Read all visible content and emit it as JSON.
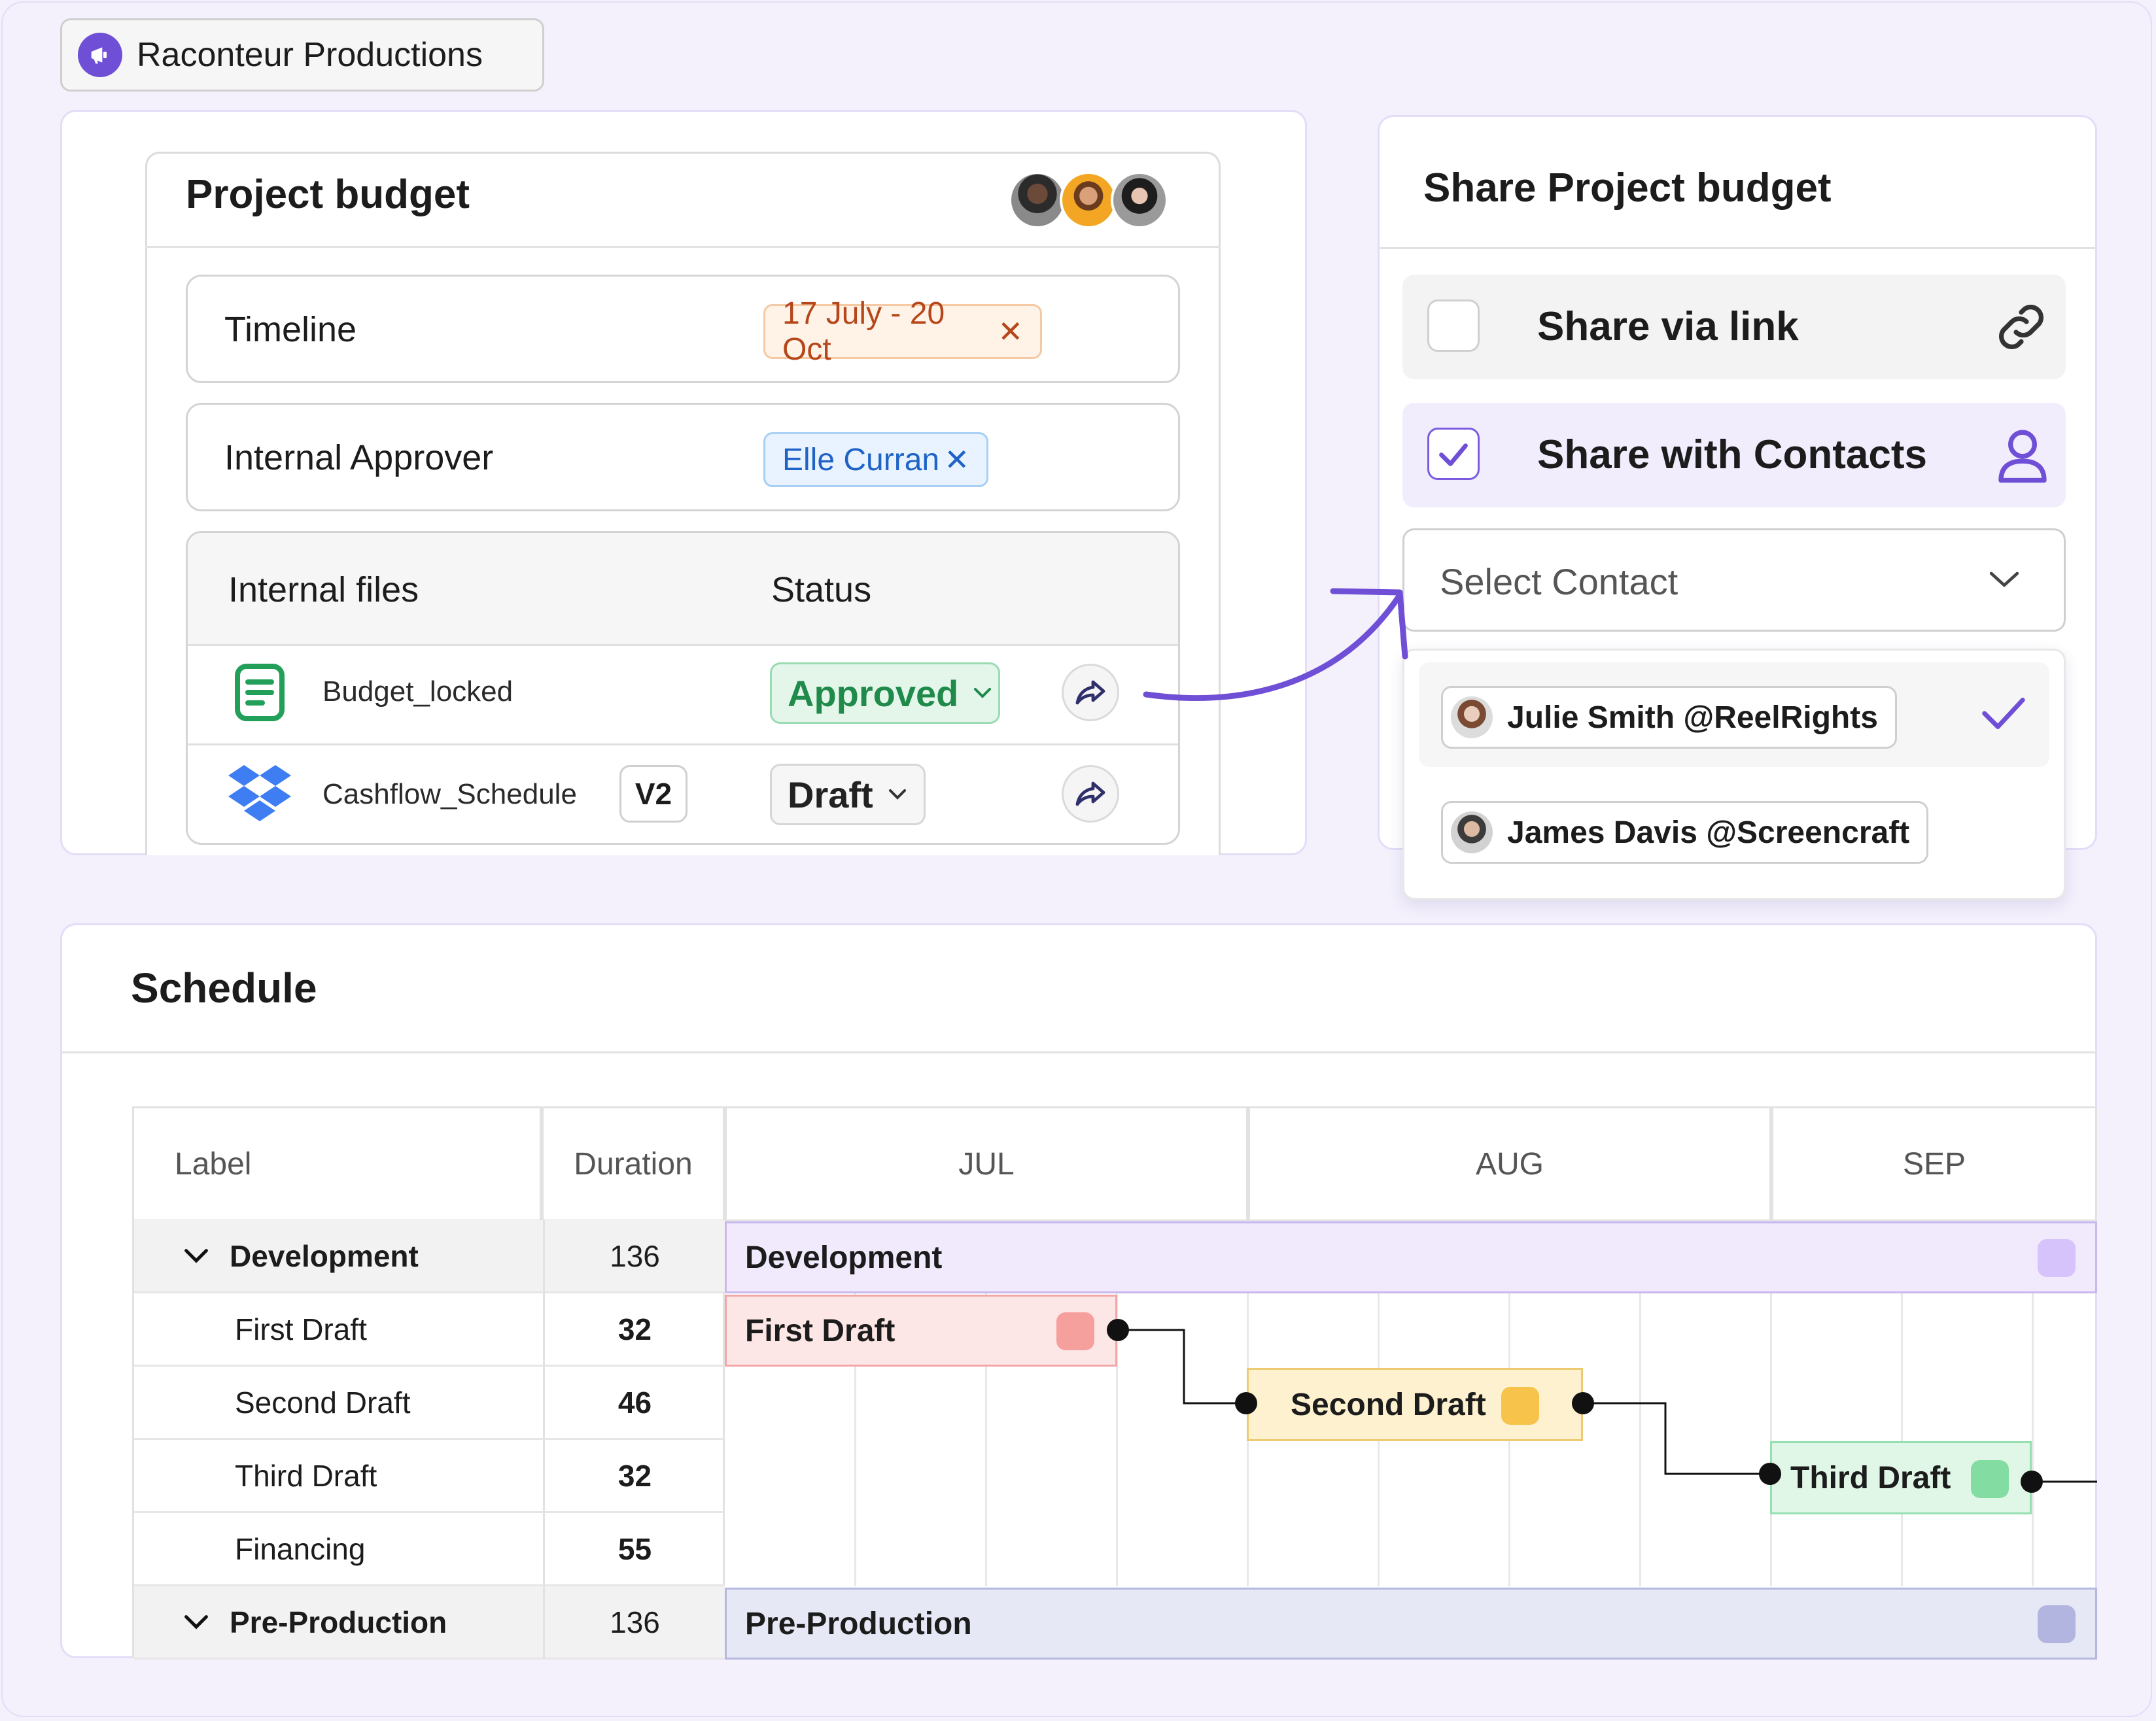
{
  "brand": {
    "name": "Raconteur Productions",
    "logo_icon": "megaphone-icon",
    "accent": "#6f4fd6"
  },
  "budget": {
    "title": "Project budget",
    "fields": [
      {
        "label": "Timeline",
        "value": "17 July - 20 Oct"
      },
      {
        "label": "Internal Approver",
        "value": "Elle Curran"
      }
    ],
    "files": {
      "headers": {
        "name": "Internal files",
        "status": "Status"
      },
      "rows": [
        {
          "name": "Budget_locked",
          "icon": "document-icon",
          "status": "Approved"
        },
        {
          "name": "Cashflow_Schedule",
          "icon": "dropbox-icon",
          "version": "V2",
          "status": "Draft"
        }
      ]
    }
  },
  "share": {
    "title": "Share Project budget",
    "options": [
      {
        "label": "Share via link",
        "checked": false,
        "icon": "link-icon"
      },
      {
        "label": "Share with Contacts",
        "checked": true,
        "icon": "user-icon"
      }
    ],
    "select_placeholder": "Select Contact",
    "contacts": [
      {
        "label": "Julie Smith @ReelRights",
        "selected": true
      },
      {
        "label": "James Davis @Screencraft",
        "selected": false
      }
    ]
  },
  "schedule": {
    "title": "Schedule",
    "headers": {
      "label": "Label",
      "duration": "Duration",
      "months": [
        "JUL",
        "AUG",
        "SEP"
      ]
    },
    "rows": [
      {
        "label": "Development",
        "duration": "136",
        "group": true
      },
      {
        "label": "First Draft",
        "duration": "32"
      },
      {
        "label": "Second Draft",
        "duration": "46"
      },
      {
        "label": "Third Draft",
        "duration": "32"
      },
      {
        "label": "Financing",
        "duration": "55"
      },
      {
        "label": "Pre-Production",
        "duration": "136",
        "group": true
      }
    ],
    "bars": [
      {
        "label": "Development",
        "color": "#f1eafd"
      },
      {
        "label": "First Draft",
        "color": "#fde6e6"
      },
      {
        "label": "Second Draft",
        "color": "#fdf1cf"
      },
      {
        "label": "Third Draft",
        "color": "#e0f7e7"
      },
      {
        "label": "Pre-Production",
        "color": "#e7e8f6"
      }
    ]
  }
}
